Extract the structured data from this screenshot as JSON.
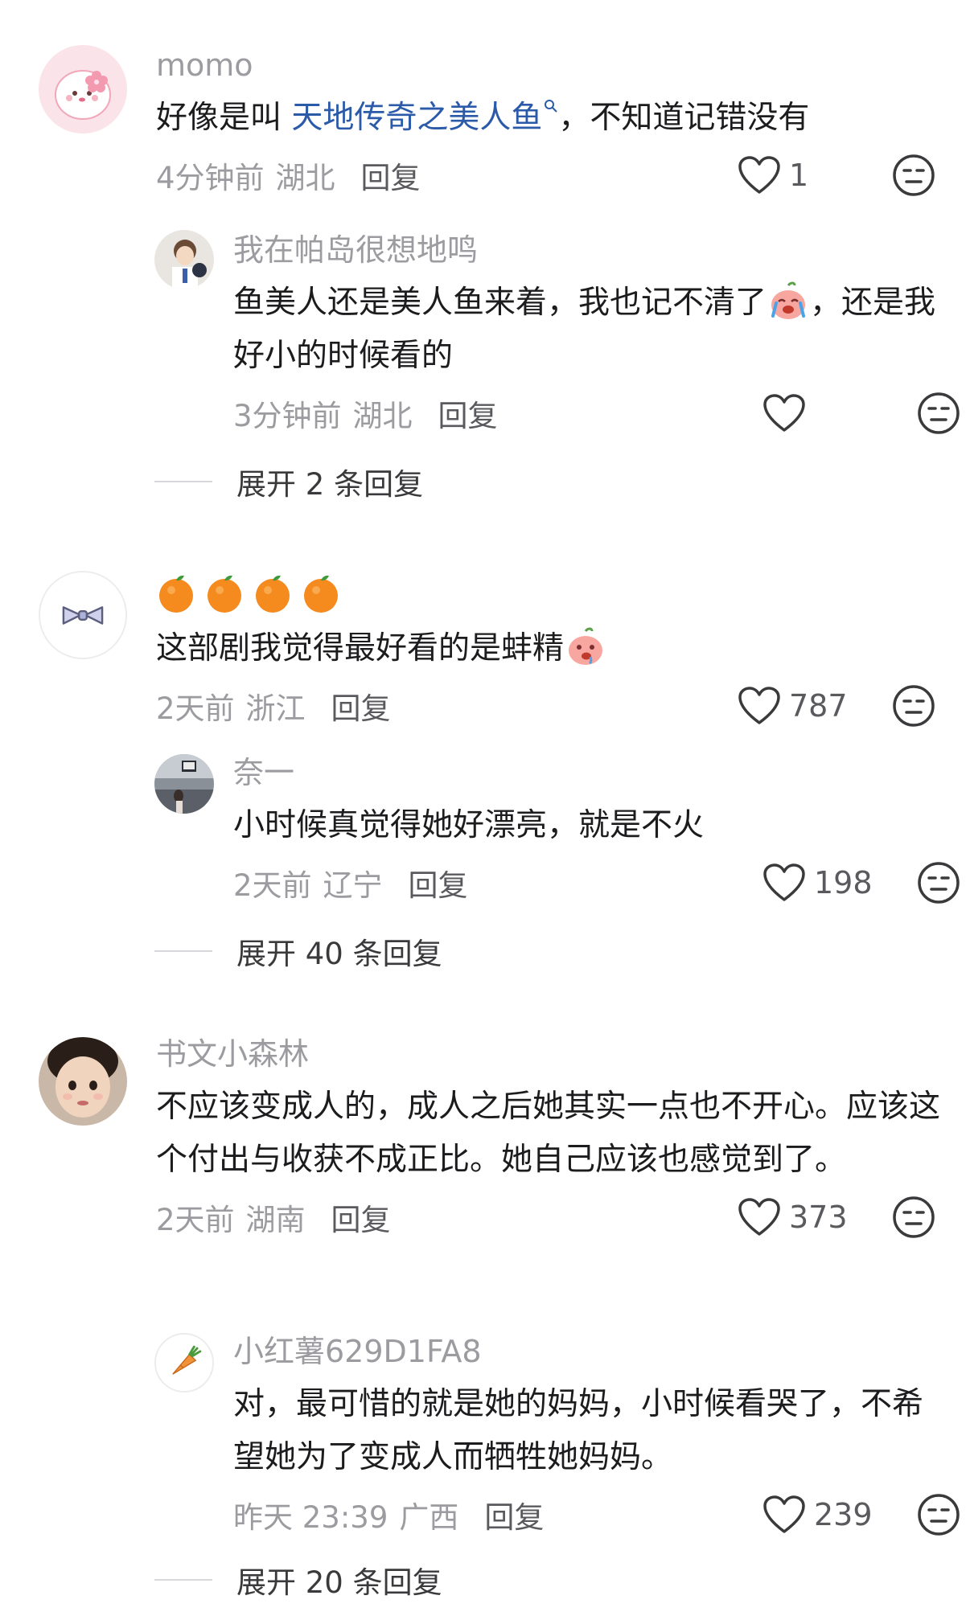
{
  "comments": [
    {
      "user": "momo",
      "text_before_link": "好像是叫 ",
      "link": "天地传奇之美人鱼",
      "link_icon": "search-superscript-icon",
      "text_after_link": "，不知道记错没有",
      "time": "4分钟前",
      "location": "湖北",
      "reply_label": "回复",
      "likes": "1",
      "replies": [
        {
          "user": "我在帕岛很想地鸣",
          "text_part1": "鱼美人还是美人鱼来着，我也记不清了",
          "emoji": "crying-face-emoji",
          "text_part2": "，还是我好小的时候看的",
          "time": "3分钟前",
          "location": "湖北",
          "reply_label": "回复",
          "likes": ""
        }
      ],
      "expand_label": "展开 2 条回复"
    },
    {
      "user": "",
      "emoji_line": [
        "orange-emoji",
        "orange-emoji",
        "orange-emoji",
        "orange-emoji"
      ],
      "text": "这部剧我觉得最好看的是蚌精",
      "text_emoji": "drooling-face-emoji",
      "time": "2天前",
      "location": "浙江",
      "reply_label": "回复",
      "likes": "787",
      "replies": [
        {
          "user": "奈一",
          "text": "小时候真觉得她好漂亮，就是不火",
          "time": "2天前",
          "location": "辽宁",
          "reply_label": "回复",
          "likes": "198"
        }
      ],
      "expand_label": "展开 40 条回复"
    },
    {
      "user": "书文小森林",
      "text": "不应该变成人的，成人之后她其实一点也不开心。应该这个付出与收获不成正比。她自己应该也感觉到了。",
      "time": "2天前",
      "location": "湖南",
      "reply_label": "回复",
      "likes": "373",
      "replies": [
        {
          "user": "小红薯629D1FA8",
          "text": "对，最可惜的就是她的妈妈，小时候看哭了，不希望她为了变成人而牺牲她妈妈。",
          "time": "昨天 23:39",
          "location": "广西",
          "reply_label": "回复",
          "likes": "239"
        }
      ],
      "expand_label": "展开 20 条回复"
    }
  ],
  "colors": {
    "link": "#2b5aa8",
    "name": "#9b9ba0",
    "text": "#1c1c1e",
    "meta": "#9b9ba0"
  }
}
